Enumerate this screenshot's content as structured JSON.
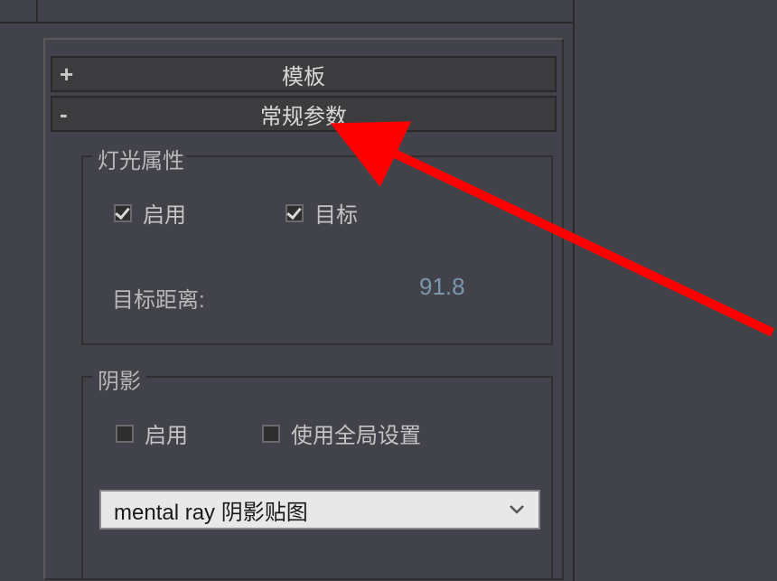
{
  "rollouts": {
    "template": {
      "sign": "+",
      "title": "模板"
    },
    "general_params": {
      "sign": "-",
      "title": "常规参数"
    }
  },
  "light_attributes": {
    "legend": "灯光属性",
    "enable": {
      "label": "启用",
      "checked": true
    },
    "target": {
      "label": "目标",
      "checked": true
    },
    "target_distance_label": "目标距离:",
    "target_distance_value": "91.8"
  },
  "shadow": {
    "legend": "阴影",
    "enable": {
      "label": "启用",
      "checked": false
    },
    "use_global": {
      "label": "使用全局设置",
      "checked": false
    },
    "dropdown_value": "mental ray 阴影贴图"
  }
}
